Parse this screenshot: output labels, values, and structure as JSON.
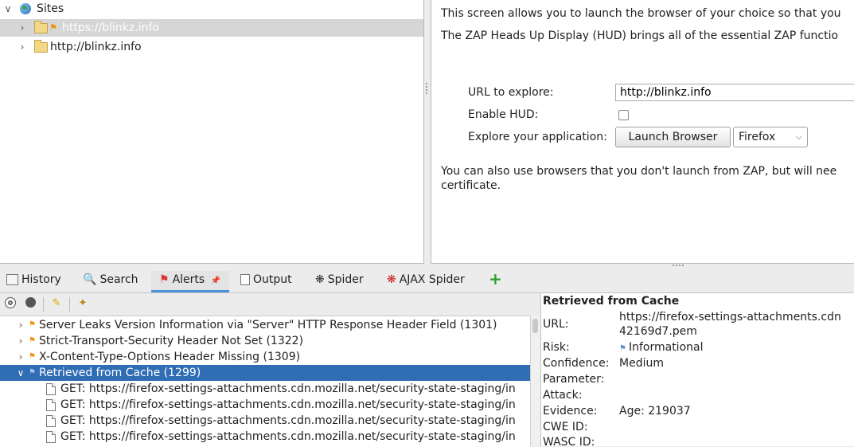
{
  "sites_tree": {
    "root_label": "Sites",
    "nodes": [
      {
        "label": "https://blinkz.info",
        "selected": true
      },
      {
        "label": "http://blinkz.info",
        "selected": false
      }
    ]
  },
  "quick_start": {
    "intro": "This screen allows you to launch the browser of your choice so that you",
    "hud_text": "The ZAP Heads Up Display (HUD) brings all of the essential ZAP functio",
    "url_label": "URL to explore:",
    "url_value": "http://blinkz.info",
    "hud_label": "Enable HUD:",
    "explore_label": "Explore your application:",
    "launch_button": "Launch Browser",
    "browser_select": "Firefox",
    "footer_line1": "You can also use browsers that you don't launch from ZAP, but will nee",
    "footer_line2": "certificate."
  },
  "tabs": [
    {
      "label": "History",
      "icon": "history-icon"
    },
    {
      "label": "Search",
      "icon": "search-icon"
    },
    {
      "label": "Alerts",
      "icon": "alerts-flag-icon"
    },
    {
      "label": "Output",
      "icon": "output-icon"
    },
    {
      "label": "Spider",
      "icon": "spider-icon"
    },
    {
      "label": "AJAX Spider",
      "icon": "ajax-spider-icon"
    }
  ],
  "alerts": [
    {
      "label": "Server Leaks Version Information via \"Server\" HTTP Response Header Field (1301)",
      "expanded": false
    },
    {
      "label": "Strict-Transport-Security Header Not Set (1322)",
      "expanded": false
    },
    {
      "label": "X-Content-Type-Options Header Missing (1309)",
      "expanded": false
    },
    {
      "label": "Retrieved from Cache (1299)",
      "expanded": true
    }
  ],
  "alert_children": [
    "GET: https://firefox-settings-attachments.cdn.mozilla.net/security-state-staging/in",
    "GET: https://firefox-settings-attachments.cdn.mozilla.net/security-state-staging/in",
    "GET: https://firefox-settings-attachments.cdn.mozilla.net/security-state-staging/in",
    "GET: https://firefox-settings-attachments.cdn.mozilla.net/security-state-staging/in"
  ],
  "details": {
    "title": "Retrieved from Cache",
    "url_label": "URL:",
    "url_line1": "https://firefox-settings-attachments.cdn",
    "url_line2": "42169d7.pem",
    "risk_label": "Risk:",
    "risk_value": "Informational",
    "confidence_label": "Confidence:",
    "confidence_value": "Medium",
    "parameter_label": "Parameter:",
    "attack_label": "Attack:",
    "evidence_label": "Evidence:",
    "evidence_value": "Age: 219037",
    "cwe_label": "CWE ID:",
    "wasc_label": "WASC ID:"
  },
  "colors": {
    "selection": "#2f6db5",
    "tab_accent": "#4a90d9",
    "flag_orange": "#e89400",
    "flag_blue": "#5b8fd0"
  }
}
